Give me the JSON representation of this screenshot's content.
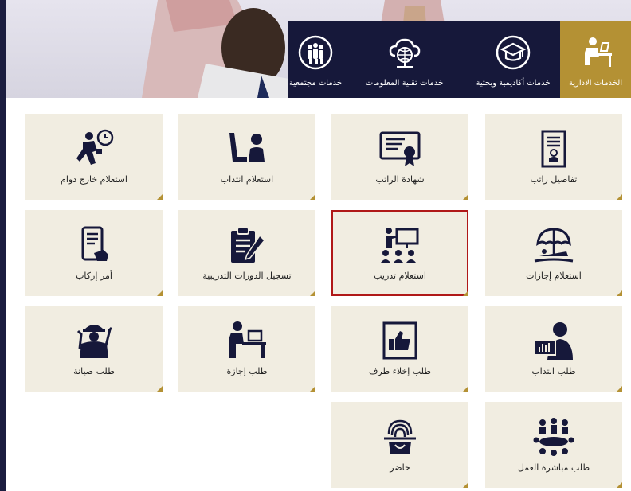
{
  "tabs": [
    {
      "label": "الخدمات الادارية",
      "icon": "office-worker-icon",
      "active": true
    },
    {
      "label": "خدمات أكاديمية وبحثية",
      "icon": "graduation-cap-icon",
      "active": false
    },
    {
      "label": "خدمات تقنية المعلومات",
      "icon": "cloud-network-icon",
      "active": false
    },
    {
      "label": "خدمات مجتمعية",
      "icon": "community-group-icon",
      "active": false
    }
  ],
  "services": [
    {
      "label": "تفاصيل راتب",
      "icon": "salary-document-icon"
    },
    {
      "label": "شهادة الراتب",
      "icon": "certificate-icon"
    },
    {
      "label": "استعلام انتداب",
      "icon": "assignment-query-icon"
    },
    {
      "label": "استعلام خارج دوام",
      "icon": "overtime-runner-icon"
    },
    {
      "label": "استعلام إجازات",
      "icon": "beach-umbrella-icon"
    },
    {
      "label": "استعلام تدريب",
      "icon": "training-presentation-icon",
      "selected": true
    },
    {
      "label": "تسجيل الدورات التدريبية",
      "icon": "clipboard-pen-icon"
    },
    {
      "label": "أمر إركاب",
      "icon": "mobile-ticket-icon"
    },
    {
      "label": "طلب انتداب",
      "icon": "monitor-chart-user-icon"
    },
    {
      "label": "طلب إخلاء طرف",
      "icon": "thumbs-up-frame-icon"
    },
    {
      "label": "طلب إجازة",
      "icon": "desk-worker-icon"
    },
    {
      "label": "طلب صيانة",
      "icon": "maintenance-worker-icon"
    },
    {
      "label": "طلب مباشرة العمل",
      "icon": "meeting-table-icon"
    },
    {
      "label": "حاضر",
      "icon": "fingerprint-icon"
    }
  ],
  "colors": {
    "navy": "#16183a",
    "gold": "#b49134",
    "card": "#f1ede1",
    "selected_border": "#b01818"
  }
}
